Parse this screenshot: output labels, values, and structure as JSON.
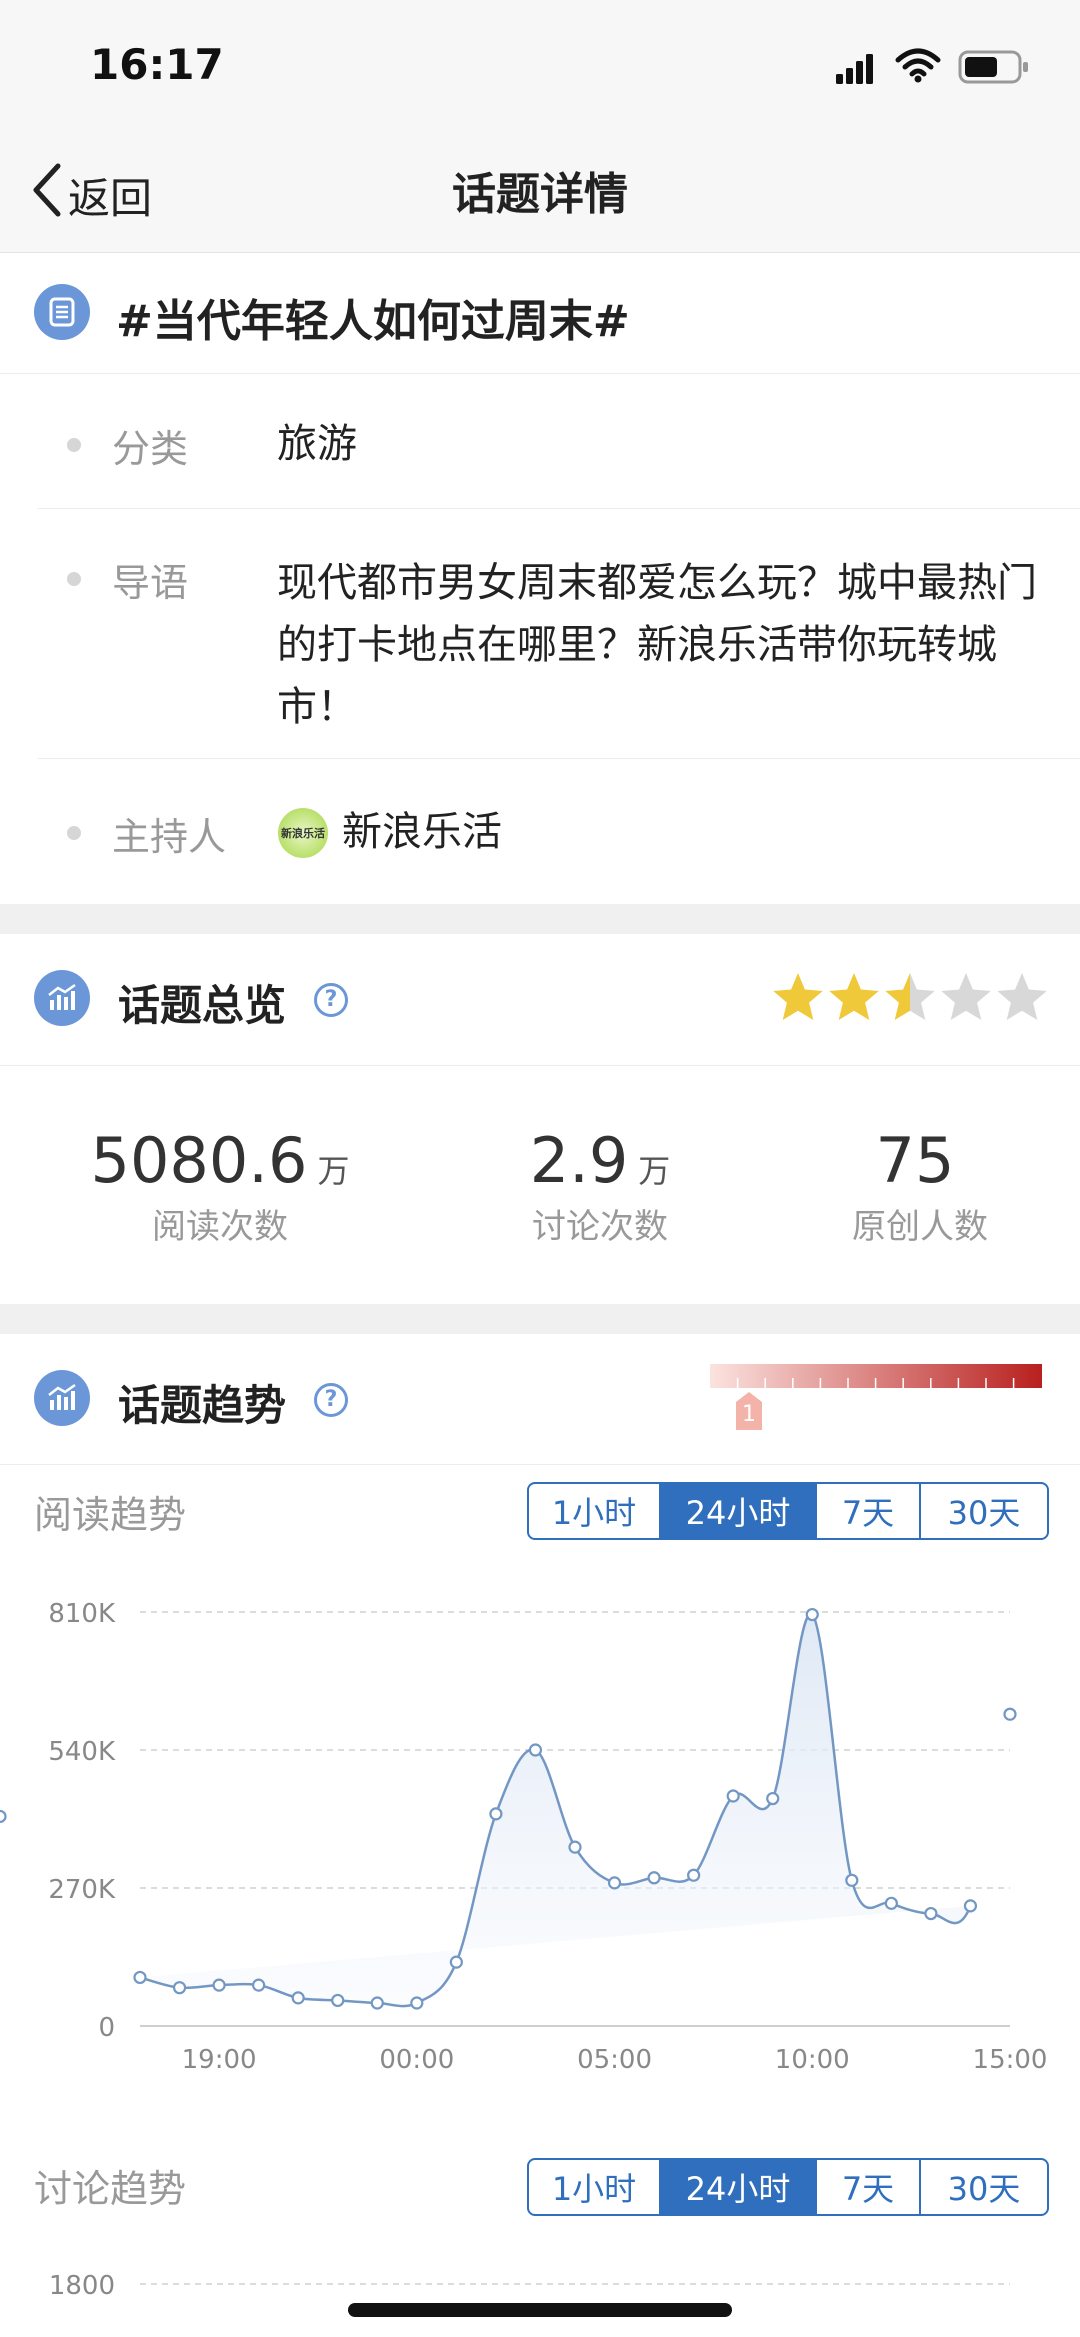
{
  "status_bar": {
    "time": "16:17"
  },
  "nav": {
    "back_label": "返回",
    "title": "话题详情"
  },
  "topic": {
    "name": "#当代年轻人如何过周末#",
    "category_label": "分类",
    "category_value": "旅游",
    "intro_label": "导语",
    "intro_value": "现代都市男女周末都爱怎么玩？城中最热门的打卡地点在哪里？新浪乐活带你玩转城市！",
    "host_label": "主持人",
    "host_value": "新浪乐活",
    "host_avatar_text": "新浪乐活"
  },
  "overview": {
    "title": "话题总览",
    "rating": 2.5,
    "rating_max": 5,
    "stats": [
      {
        "value": "5080.6",
        "unit": "万",
        "label": "阅读次数"
      },
      {
        "value": "2.9",
        "unit": "万",
        "label": "讨论次数"
      },
      {
        "value": "75",
        "unit": "",
        "label": "原创人数"
      }
    ]
  },
  "trend": {
    "title": "话题趋势",
    "heat_level": "1",
    "heat_colors": [
      "#fbe3df",
      "#b8201f"
    ],
    "read_title": "阅读趋势",
    "discuss_title": "讨论趋势",
    "ranges": [
      "1小时",
      "24小时",
      "7天",
      "30天"
    ],
    "active_range": "24小时"
  },
  "chart_data": [
    {
      "type": "area",
      "title": "阅读趋势",
      "y_ticks": [
        "810K",
        "540K",
        "270K",
        "0"
      ],
      "x_ticks": [
        "19:00",
        "00:00",
        "05:00",
        "10:00",
        "15:00"
      ],
      "ylim": [
        0,
        810000
      ],
      "hours": [
        -7,
        -6,
        -5,
        -4,
        -3,
        -2,
        -1,
        0,
        1,
        2,
        3,
        4,
        5,
        6,
        7,
        8,
        9,
        10,
        11,
        12,
        13,
        14,
        15
      ],
      "x_tick_hours": [
        -5,
        0,
        5,
        10,
        15
      ],
      "values": [
        95000,
        75000,
        80000,
        80000,
        55000,
        50000,
        45000,
        45000,
        125000,
        415000,
        540000,
        350000,
        280000,
        290000,
        295000,
        450000,
        445000,
        805000,
        285000,
        240000,
        220000,
        235000,
        610000,
        410000
      ],
      "grid": true,
      "color": "#7397c4"
    },
    {
      "type": "area",
      "title": "讨论趋势",
      "y_ticks": [
        "1800"
      ],
      "grid": true
    }
  ]
}
